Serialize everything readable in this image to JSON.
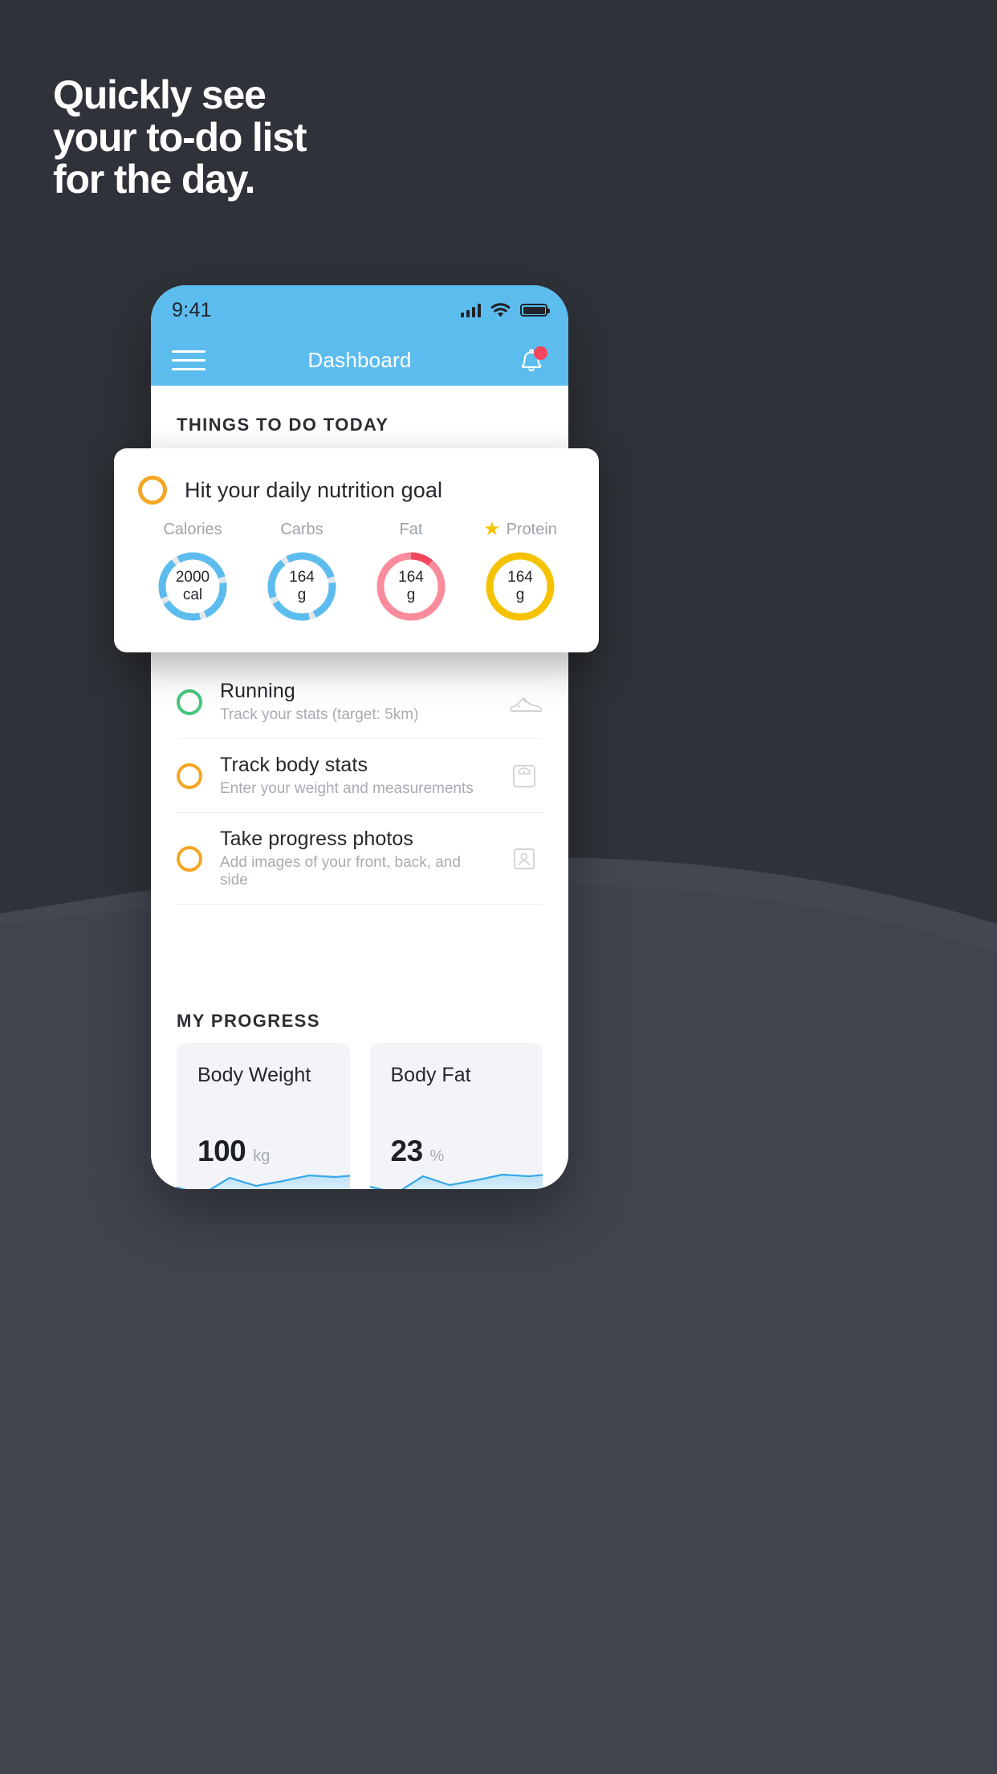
{
  "colors": {
    "bg_top": "#2f3238",
    "bg_bottom": "#434751",
    "brand_blue": "#5dbcee",
    "accent_orange": "#f5a623",
    "accent_yellow": "#f5c200",
    "accent_green": "#47c67c",
    "accent_red": "#f6465d",
    "accent_pink": "#f98c9c"
  },
  "headline": {
    "line1": "Quickly see",
    "line2": "your to-do list",
    "line3": "for the day."
  },
  "phone": {
    "status_bar": {
      "time": "9:41",
      "signal_icon": "cellular-signal-icon",
      "wifi_icon": "wifi-icon",
      "battery_icon": "battery-full-icon"
    },
    "nav_bar": {
      "menu_icon": "hamburger-menu-icon",
      "title": "Dashboard",
      "bell_icon": "notification-bell-icon",
      "bell_badge": true
    },
    "sections": {
      "todo_heading": "THINGS TO DO TODAY",
      "progress_heading": "MY PROGRESS"
    },
    "todo_items": [
      {
        "title": "Running",
        "subtitle": "Track your stats (target: 5km)",
        "ring_color": "green",
        "icon": "running-shoe-icon"
      },
      {
        "title": "Track body stats",
        "subtitle": "Enter your weight and measurements",
        "ring_color": "orange",
        "icon": "weight-scale-icon"
      },
      {
        "title": "Take progress photos",
        "subtitle": "Add images of your front, back, and side",
        "ring_color": "orange",
        "icon": "person-photo-icon"
      }
    ],
    "progress_cards": [
      {
        "title": "Body Weight",
        "value": "100",
        "unit": "kg"
      },
      {
        "title": "Body Fat",
        "value": "23",
        "unit": "%"
      }
    ]
  },
  "nutrition_card": {
    "checkbox_ring_color": "orange",
    "title": "Hit your daily nutrition goal",
    "macros": [
      {
        "label": "Calories",
        "value": "2000",
        "unit": "cal",
        "ring_color": "#5dbcee",
        "track_color": "#e4e7ea",
        "starred": false,
        "segments": 4,
        "percent": 92
      },
      {
        "label": "Carbs",
        "value": "164",
        "unit": "g",
        "ring_color": "#5dbcee",
        "track_color": "#e4e7ea",
        "starred": false,
        "segments": 4,
        "percent": 92
      },
      {
        "label": "Fat",
        "value": "164",
        "unit": "g",
        "ring_color": "#f98c9c",
        "track_color": "#f1475f",
        "starred": false,
        "segments": 1,
        "percent": 88
      },
      {
        "label": "Protein",
        "value": "164",
        "unit": "g",
        "ring_color": "#f5c200",
        "track_color": "#f5c200",
        "starred": true,
        "segments": 0,
        "percent": 100
      }
    ]
  },
  "chart_data": [
    {
      "type": "area",
      "title": "Body Weight",
      "ylabel": "kg",
      "x": [
        0,
        1,
        2,
        3,
        4,
        5,
        6
      ],
      "values": [
        100,
        99,
        98,
        101,
        99,
        100,
        101
      ]
    },
    {
      "type": "area",
      "title": "Body Fat",
      "ylabel": "%",
      "x": [
        0,
        1,
        2,
        3,
        4,
        5,
        6
      ],
      "values": [
        23,
        22,
        21,
        24,
        22,
        23,
        24
      ]
    }
  ]
}
